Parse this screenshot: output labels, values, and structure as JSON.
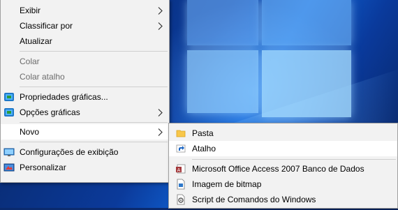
{
  "main_menu": {
    "items": [
      {
        "label": "Exibir",
        "icon": "none",
        "submenu": true
      },
      {
        "label": "Classificar por",
        "icon": "none",
        "submenu": true
      },
      {
        "label": "Atualizar",
        "icon": "none",
        "submenu": false
      },
      {
        "label": "Colar",
        "icon": "none",
        "disabled": true
      },
      {
        "label": "Colar atalho",
        "icon": "none",
        "disabled": true
      },
      {
        "label": "Propriedades gráficas...",
        "icon": "intel-graphics-icon"
      },
      {
        "label": "Opções gráficas",
        "icon": "intel-graphics-icon",
        "submenu": true
      },
      {
        "label": "Novo",
        "icon": "none",
        "submenu": true,
        "highlighted": true
      },
      {
        "label": "Configurações de exibição",
        "icon": "display-icon"
      },
      {
        "label": "Personalizar",
        "icon": "personalize-icon"
      }
    ]
  },
  "sub_menu": {
    "items": [
      {
        "label": "Pasta",
        "icon": "folder-icon"
      },
      {
        "label": "Atalho",
        "icon": "shortcut-icon",
        "highlighted": true
      },
      {
        "label": "Microsoft Office Access 2007 Banco de Dados",
        "icon": "access-icon"
      },
      {
        "label": "Imagem de bitmap",
        "icon": "bitmap-icon"
      },
      {
        "label": "Script de Comandos do Windows",
        "icon": "script-icon"
      }
    ]
  },
  "colors": {
    "menu_bg": "#f2f2f2",
    "highlight_bg": "#ffffff",
    "disabled_text": "#6d6d6d",
    "desktop_blue": "#0b3a9a"
  }
}
